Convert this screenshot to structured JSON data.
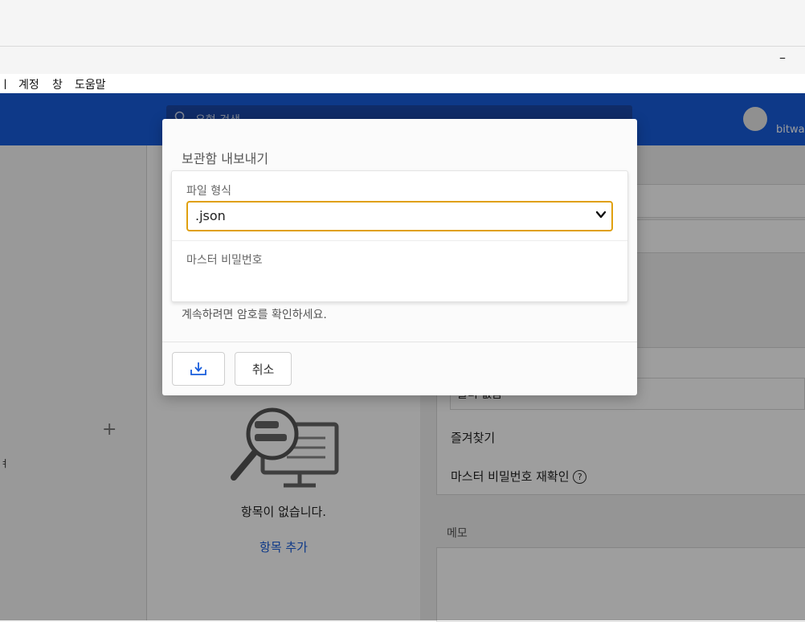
{
  "window": {
    "minimize_glyph": "–"
  },
  "menu": [
    "ㅣ",
    "계정",
    "창",
    "도움말"
  ],
  "header": {
    "search_placeholder": "유형 검색",
    "brand": "bitwa"
  },
  "vault": {
    "empty_message": "항목이 없습니다.",
    "add_item_link": "항목 추가"
  },
  "detail_panel": {
    "folder_value": "폴더 없음",
    "favorite_label": "즐겨찾기",
    "reprompt_label": "마스터 비밀번호 재확인",
    "help_glyph": "?",
    "notes_label": "메모"
  },
  "export_dialog": {
    "title": "보관함 내보내기",
    "file_format_label": "파일 형식",
    "file_format_value": ".json",
    "master_password_label": "마스터 비밀번호",
    "hint": "계속하려면 암호를 확인하세요.",
    "cancel_label": "취소",
    "download_icon": "download-icon"
  },
  "colors": {
    "header_blue": "#175ddc",
    "focus_outline": "#e0a010",
    "link_blue": "#175ddc"
  }
}
